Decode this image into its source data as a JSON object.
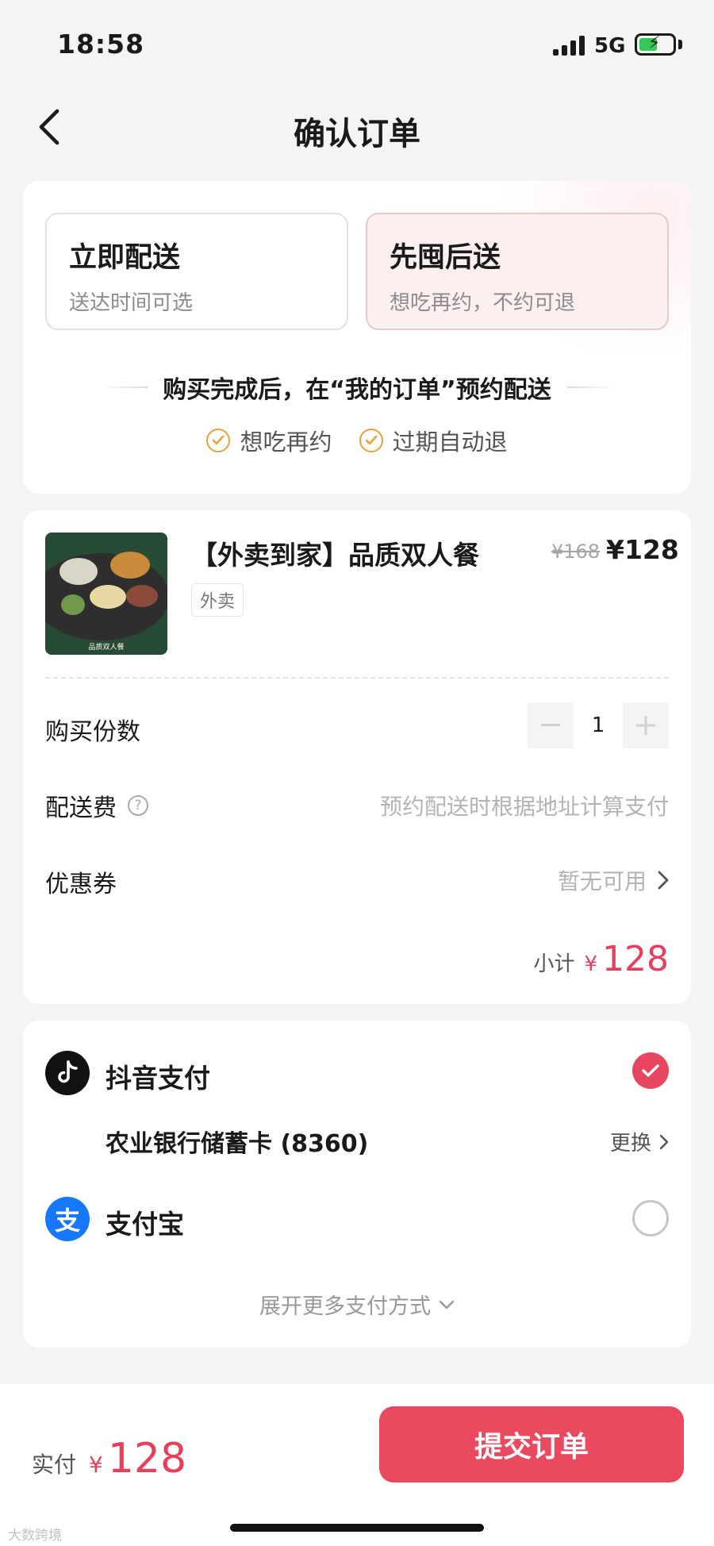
{
  "status_bar": {
    "time": "18:58",
    "network": "5G"
  },
  "header": {
    "title": "确认订单"
  },
  "delivery": {
    "options": [
      {
        "title": "立即配送",
        "subtitle": "送达时间可选"
      },
      {
        "title": "先囤后送",
        "subtitle": "想吃再约，不约可退"
      }
    ],
    "hint": "购买完成后，在“我的订单”预约配送",
    "features": [
      "想吃再约",
      "过期自动退"
    ]
  },
  "product": {
    "name": "【外卖到家】品质双人餐",
    "original_price": "¥168",
    "price": "¥128",
    "tag": "外卖",
    "image_caption": "品质双人餐"
  },
  "order": {
    "quantity_label": "购买份数",
    "quantity": "1",
    "fee_label": "配送费",
    "fee_value": "预约配送时根据地址计算支付",
    "coupon_label": "优惠券",
    "coupon_value": "暂无可用",
    "subtotal_label": "小计",
    "subtotal_currency": "¥",
    "subtotal_value": "128"
  },
  "payment": {
    "douyin_label": "抖音支付",
    "card_label": "农业银行储蓄卡 (8360)",
    "change_label": "更换",
    "alipay_label": "支付宝",
    "more_label": "展开更多支付方式",
    "selected": "抖音支付"
  },
  "footer": {
    "total_label": "实付",
    "total_currency": "¥",
    "total_value": "128",
    "submit_label": "提交订单",
    "watermark": "大数跨境"
  },
  "colors": {
    "accent": "#ea4a60",
    "price_red": "#e83e5c",
    "check_orange": "#e9a23b",
    "alipay_blue": "#1677ff"
  },
  "icons": [
    "back-icon",
    "signal-icon",
    "battery-icon",
    "check-circle-icon",
    "minus-icon",
    "plus-icon",
    "help-icon",
    "chevron-right-icon",
    "douyin-icon",
    "alipay-icon",
    "checkmark-icon",
    "chevron-down-icon"
  ]
}
